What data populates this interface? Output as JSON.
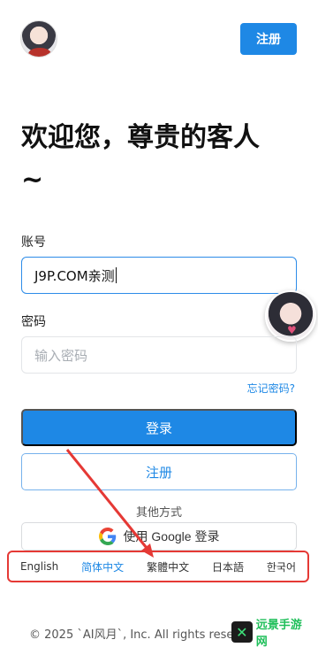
{
  "header": {
    "register_button": "注册"
  },
  "headline": "欢迎您，尊贵的客人 ~",
  "form": {
    "account_label": "账号",
    "account_value": "J9P.COM亲测",
    "password_label": "密码",
    "password_placeholder": "输入密码",
    "forgot_password": "忘记密码?",
    "login_button": "登录",
    "register_button": "注册"
  },
  "other_methods": {
    "label": "其他方式",
    "google_button": "使用 Google 登录"
  },
  "languages": [
    {
      "label": "English",
      "active": false
    },
    {
      "label": "简体中文",
      "active": true
    },
    {
      "label": "繁體中文",
      "active": false
    },
    {
      "label": "日本語",
      "active": false
    },
    {
      "label": "한국어",
      "active": false
    }
  ],
  "footer": {
    "copyright": "© 2025 `AI风月`, Inc. All rights reserved."
  },
  "watermark": {
    "text": "远景手游网"
  },
  "colors": {
    "accent": "#1e88e5",
    "annotation": "#e53935"
  }
}
